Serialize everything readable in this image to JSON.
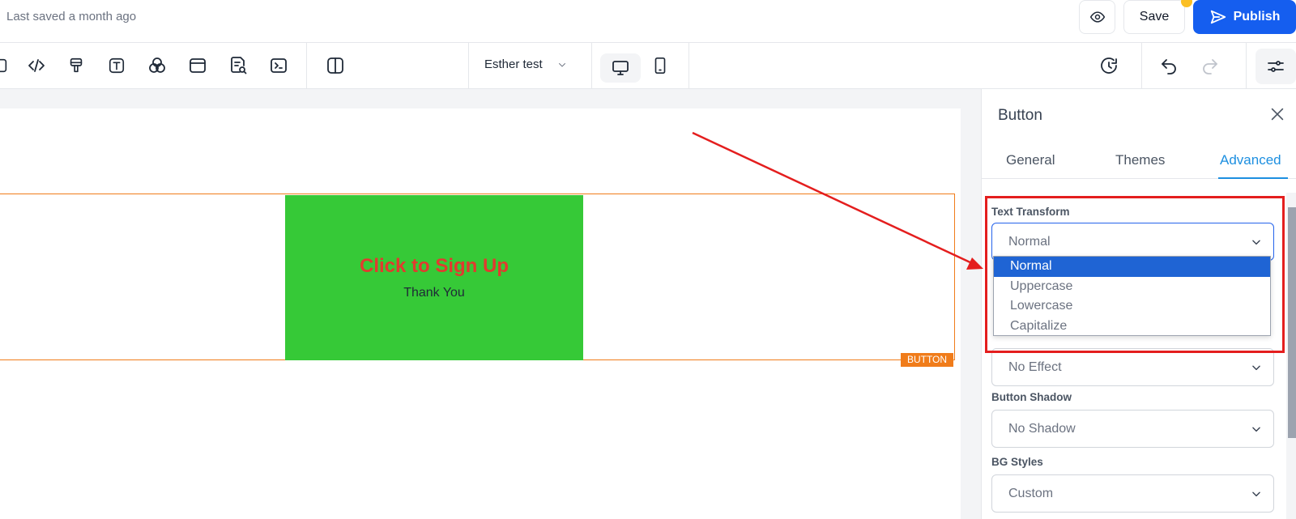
{
  "header": {
    "last_saved": "Last saved a month ago",
    "save_label": "Save",
    "publish_label": "Publish"
  },
  "toolbar": {
    "page_name": "Esther test"
  },
  "canvas": {
    "button_main_text": "Click to Sign Up",
    "button_sub_text": "Thank You",
    "element_tag": "BUTTON"
  },
  "panel": {
    "title": "Button",
    "tabs": [
      {
        "label": "General",
        "active": false
      },
      {
        "label": "Themes",
        "active": false
      },
      {
        "label": "Advanced",
        "active": true
      }
    ],
    "fields": {
      "text_transform_label": "Text Transform",
      "text_transform_value": "Normal",
      "hover_effect_value": "No Effect",
      "button_shadow_label": "Button Shadow",
      "button_shadow_value": "No Shadow",
      "bg_styles_label": "BG Styles",
      "bg_styles_value": "Custom"
    },
    "text_transform_options": [
      "Normal",
      "Uppercase",
      "Lowercase",
      "Capitalize"
    ]
  },
  "colors": {
    "accent": "#155eef",
    "button_bg": "#36c937",
    "button_text": "#e03b2f",
    "selection_outline": "#f07c1a",
    "annotation": "#e41e1e",
    "active_tab": "#1d8fe0"
  }
}
